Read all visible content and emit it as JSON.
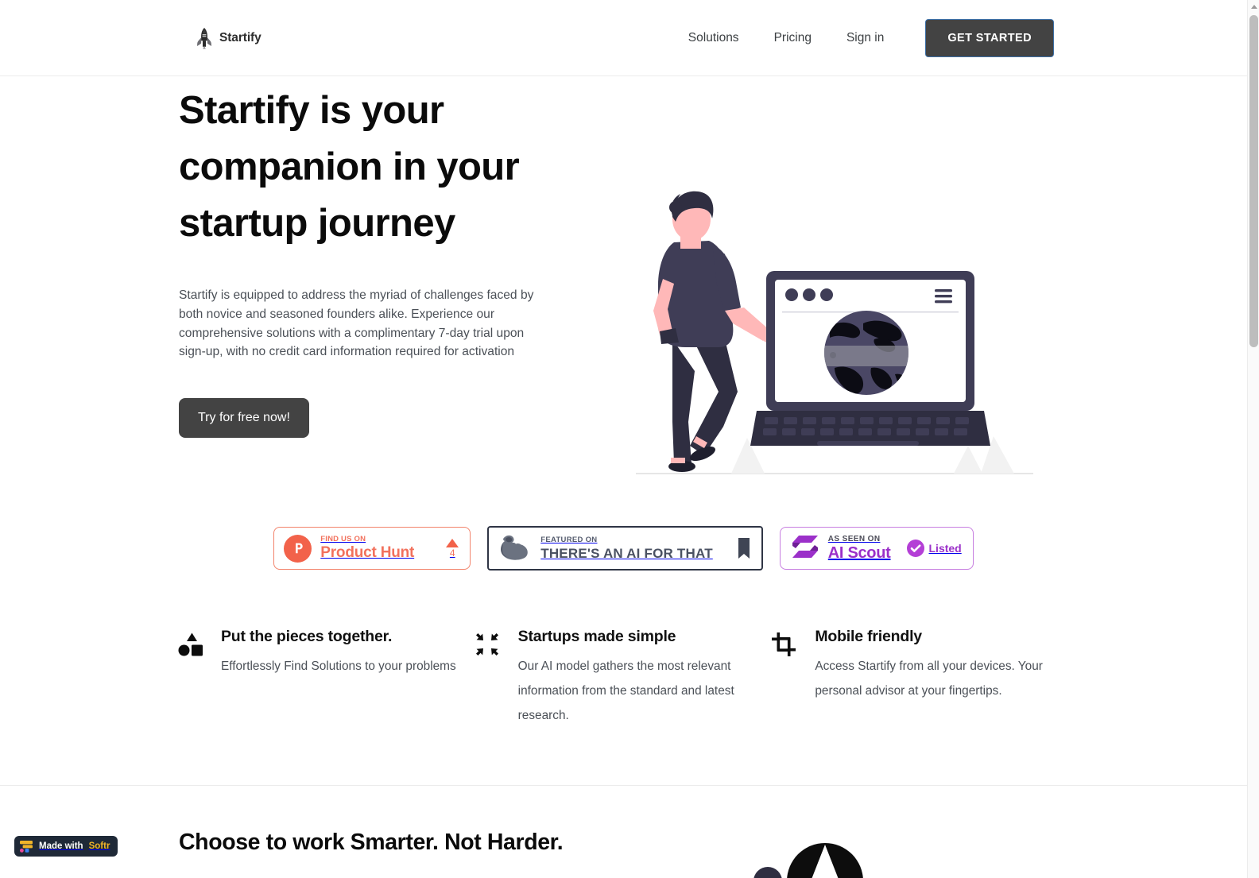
{
  "header": {
    "brand": "Startify",
    "brand_icon": "rocket-icon",
    "nav": [
      {
        "label": "Solutions"
      },
      {
        "label": "Pricing"
      },
      {
        "label": "Sign in"
      }
    ],
    "cta_label": "GET STARTED",
    "cta_bg": "#434343",
    "cta_border": "#3b6ea5"
  },
  "hero": {
    "title": "Startify is your companion in your startup journey",
    "paragraph": "Startify is equipped to address the myriad of challenges faced by both novice and seasoned founders alike. Experience our comprehensive solutions with a complimentary 7-day trial upon sign-up, with no credit card information required for activation",
    "cta_label": "Try for free now!",
    "cta_bg": "#434343",
    "illustration": "person-leaning-on-laptop-with-globe-illustration",
    "illustration_colors": {
      "navy": "#3f3d56",
      "dark": "#2f2e41",
      "skin": "#ffb8b8",
      "globe": "#4a4765"
    }
  },
  "badges": [
    {
      "id": "product-hunt",
      "small": "FIND US ON",
      "big": "Product Hunt",
      "vote_count": "4",
      "accent": "#f2715c",
      "logo": "product-hunt-p-icon",
      "vote_icon": "upvote-triangle-icon"
    },
    {
      "id": "theres-an-ai-for-that",
      "small": "FEATURED ON",
      "big": "THERE'S AN AI FOR THAT",
      "accent": "#2f3545",
      "logo": "flexed-bicep-icon",
      "end_icon": "bookmark-icon"
    },
    {
      "id": "ai-scout",
      "small": "AS SEEN ON",
      "big": "AI Scout",
      "status": "Listed",
      "accent": "#9b30c9",
      "logo": "ai-scout-s-icon",
      "status_icon": "check-circle-icon"
    }
  ],
  "features": [
    {
      "icon": "shapes-icon",
      "title": "Put the pieces together.",
      "desc": "Effortlessly Find Solutions to your problems"
    },
    {
      "icon": "compress-arrows-icon",
      "title": "Startups made simple",
      "desc": "Our AI model gathers the most relevant information from the standard and latest research."
    },
    {
      "icon": "crop-icon",
      "title": "Mobile friendly",
      "desc": "Access Startify from all your devices. Your personal advisor at your fingertips."
    }
  ],
  "bottom": {
    "title": "Choose to work Smarter. Not Harder."
  },
  "softr": {
    "prefix": "Made with",
    "name": "Softr",
    "bg": "#1f2937",
    "name_color": "#f0b429",
    "icon": "softr-logo-icon"
  },
  "scrollbar": {
    "up_icon": "scroll-up-arrow-icon",
    "thumb": "scrollbar-thumb"
  }
}
